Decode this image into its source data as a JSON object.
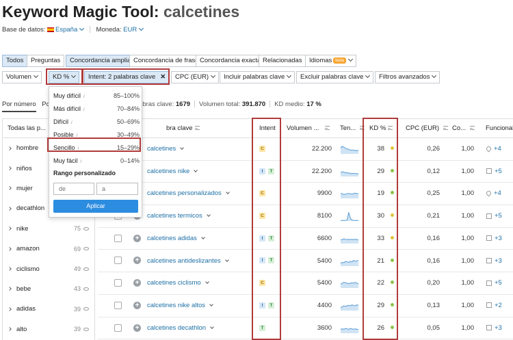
{
  "header": {
    "title_prefix": "Keyword Magic Tool:",
    "title_keyword": "calcetines",
    "database_label": "Base de datos:",
    "database_value": "España",
    "currency_label": "Moneda:",
    "currency_value": "EUR"
  },
  "filters_row1": [
    "Todos",
    "Preguntas",
    "Concordancia amplia",
    "Concordancia de frase",
    "Concordancia exacta",
    "Relacionadas",
    "Idiomas"
  ],
  "beta_label": "beta",
  "filters_row2": {
    "volumen": "Volumen",
    "kd": "KD %",
    "intent": "Intent: 2 palabras clave",
    "cpc": "CPC (EUR)",
    "incluir": "Incluir palabras clave",
    "excluir": "Excluir palabras clave",
    "avanzados": "Filtros avanzados"
  },
  "tabs": {
    "by_number": "Por número",
    "by_volume_partial": "Po"
  },
  "stats": {
    "keywords_label": "abras clave:",
    "keywords_value": "1679",
    "volume_label": "Volumen total:",
    "volume_value": "391.870",
    "kd_label": "KD medio:",
    "kd_value": "17 %"
  },
  "kd_dropdown": {
    "options": [
      {
        "label": "Muy difícil",
        "range": "85–100%"
      },
      {
        "label": "Más difícil",
        "range": "70–84%"
      },
      {
        "label": "Difícil",
        "range": "50–69%"
      },
      {
        "label": "Posible",
        "range": "30–49%"
      },
      {
        "label": "Sencillo",
        "range": "15–29%"
      },
      {
        "label": "Muy fácil",
        "range": "0–14%"
      }
    ],
    "info_glyph": "i",
    "custom_range_title": "Rango personalizado",
    "from_placeholder": "de",
    "to_placeholder": "a",
    "apply_label": "Aplicar"
  },
  "sidebar": {
    "header": "Todas las p...",
    "items": [
      {
        "label": "hombre",
        "count": ""
      },
      {
        "label": "niños",
        "count": ""
      },
      {
        "label": "mujer",
        "count": ""
      },
      {
        "label": "decathlon",
        "count": ""
      },
      {
        "label": "nike",
        "count": "75"
      },
      {
        "label": "amazon",
        "count": "69"
      },
      {
        "label": "ciclismo",
        "count": "49"
      },
      {
        "label": "bebe",
        "count": "43"
      },
      {
        "label": "adidas",
        "count": "39"
      },
      {
        "label": "alto",
        "count": "39"
      }
    ]
  },
  "table": {
    "columns": {
      "keyword": "bra clave",
      "intent": "Intent",
      "volume": "Volumen ...",
      "trend": "Ten...",
      "kd": "KD %",
      "cpc": "CPC (EUR)",
      "competition": "Co...",
      "features": "Funcionali"
    },
    "rows": [
      {
        "keyword": "calcetines",
        "intent": [
          "C"
        ],
        "volume": "22.200",
        "trend": [
          0.6,
          0.8,
          0.7,
          0.6,
          0.5,
          0.5,
          0.4,
          0.4,
          0.4,
          0.35,
          0.35,
          0.4
        ],
        "kd": "38",
        "kd_color": "#e0c43a",
        "cpc": "0,26",
        "comp": "1,00",
        "feature_icon": "location-pin-icon",
        "feature_more": "+4"
      },
      {
        "keyword": "calcetines nike",
        "intent": [
          "I",
          "T"
        ],
        "volume": "22.200",
        "trend": [
          0.4,
          0.5,
          0.45,
          0.4,
          0.4,
          0.35,
          0.35,
          0.3,
          0.35,
          0.3,
          0.3,
          0.3
        ],
        "kd": "29",
        "kd_color": "#8bc34a",
        "cpc": "0,12",
        "comp": "1,00",
        "feature_icon": "image-icon",
        "feature_more": "+5"
      },
      {
        "keyword": "calcetines personalizados",
        "intent": [
          "C"
        ],
        "volume": "9900",
        "trend": [
          0.5,
          0.5,
          0.4,
          0.45,
          0.5,
          0.5,
          0.5,
          0.45,
          0.5,
          0.55,
          0.5,
          0.5
        ],
        "kd": "19",
        "kd_color": "#8bc34a",
        "cpc": "0,25",
        "comp": "1,00",
        "feature_icon": "location-pin-icon",
        "feature_more": "+4"
      },
      {
        "keyword": "calcetines termicos",
        "intent": [
          "C"
        ],
        "volume": "8100",
        "trend": [
          0.05,
          0.05,
          0.05,
          0.05,
          0.1,
          0.9,
          0.3,
          0.1,
          0.05,
          0.05,
          0.05,
          0.05
        ],
        "kd": "30",
        "kd_color": "#e0c43a",
        "cpc": "0,21",
        "comp": "1,00",
        "feature_icon": "image-icon",
        "feature_more": "+5"
      },
      {
        "keyword": "calcetines adidas",
        "intent": [
          "I",
          "T"
        ],
        "volume": "6600",
        "trend": [
          0.4,
          0.4,
          0.5,
          0.45,
          0.4,
          0.45,
          0.4,
          0.45,
          0.4,
          0.45,
          0.4,
          0.4
        ],
        "kd": "33",
        "kd_color": "#e0c43a",
        "cpc": "0,16",
        "comp": "1,00",
        "feature_icon": "image-icon",
        "feature_more": "+3"
      },
      {
        "keyword": "calcetines antideslizantes",
        "intent": [
          "I",
          "T"
        ],
        "volume": "5400",
        "trend": [
          0.3,
          0.4,
          0.35,
          0.5,
          0.45,
          0.4,
          0.5,
          0.45,
          0.6,
          0.5,
          0.55,
          0.6
        ],
        "kd": "21",
        "kd_color": "#8bc34a",
        "cpc": "0,16",
        "comp": "1,00",
        "feature_icon": "image-icon",
        "feature_more": "+3"
      },
      {
        "keyword": "calcetines ciclismo",
        "intent": [
          "C"
        ],
        "volume": "5400",
        "trend": [
          0.4,
          0.5,
          0.6,
          0.55,
          0.5,
          0.45,
          0.5,
          0.55,
          0.5,
          0.6,
          0.5,
          0.45
        ],
        "kd": "22",
        "kd_color": "#8bc34a",
        "cpc": "0,20",
        "comp": "1,00",
        "feature_icon": "image-icon",
        "feature_more": "+5"
      },
      {
        "keyword": "calcetines nike altos",
        "intent": [
          "I",
          "T"
        ],
        "volume": "4400",
        "trend": [
          0.3,
          0.4,
          0.5,
          0.45,
          0.5,
          0.55,
          0.5,
          0.6,
          0.55,
          0.5,
          0.6,
          0.55
        ],
        "kd": "29",
        "kd_color": "#8bc34a",
        "cpc": "0,13",
        "comp": "1,00",
        "feature_icon": "link-icon",
        "feature_more": "+2"
      },
      {
        "keyword": "calcetines decathlon",
        "intent": [
          "T"
        ],
        "volume": "3600",
        "trend": [
          0.4,
          0.45,
          0.4,
          0.5,
          0.45,
          0.4,
          0.5,
          0.45,
          0.4,
          0.45,
          0.4,
          0.4
        ],
        "kd": "26",
        "kd_color": "#8bc34a",
        "cpc": "0,05",
        "comp": "1,00",
        "feature_icon": "image-icon",
        "feature_more": "+3"
      }
    ]
  },
  "colors": {
    "link": "#1d6fa5",
    "highlight_border": "#b03a3a",
    "apply_button": "#2c8ce0",
    "kd_easy": "#8bc34a",
    "kd_possible": "#e0c43a"
  }
}
